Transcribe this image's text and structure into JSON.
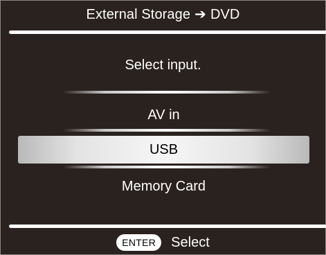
{
  "title": {
    "source": "External Storage",
    "arrow": "➔",
    "target": "DVD"
  },
  "prompt": "Select input.",
  "options": [
    {
      "label": "AV in",
      "selected": false
    },
    {
      "label": "USB",
      "selected": true
    },
    {
      "label": "Memory Card",
      "selected": false
    }
  ],
  "footer": {
    "key_label": "ENTER",
    "action_label": "Select"
  },
  "colors": {
    "background": "#2a221f",
    "text": "#ffffff",
    "highlight": "#f6f6f6",
    "highlight_text": "#000000"
  }
}
